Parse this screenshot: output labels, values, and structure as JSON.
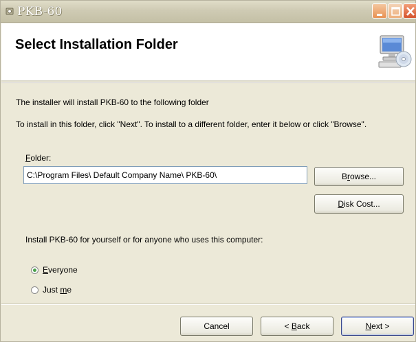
{
  "window": {
    "title": "PKB-60",
    "icon": "setup-icon",
    "controls": [
      "minimize-icon",
      "maximize-icon",
      "close-icon"
    ]
  },
  "banner": {
    "title": "Select Installation Folder",
    "icon": "computer-disc-icon"
  },
  "body": {
    "line1": "The installer will install PKB-60 to the following folder",
    "line2": "To install in this folder, click \"Next\". To install to a different folder, enter it below or click \"Browse\".",
    "folder_label_accel": "F",
    "folder_label_rest": "older:",
    "folder_value": "C:\\Program Files\\ Default Company Name\\ PKB-60\\",
    "browse_pre": "B",
    "browse_accel": "r",
    "browse_post": "owse...",
    "diskcost_accel": "D",
    "diskcost_rest": "isk Cost...",
    "install_for": "Install PKB-60 for yourself or for anyone who uses this computer:",
    "options": [
      {
        "accel": "E",
        "rest": "veryone",
        "selected": true
      },
      {
        "pre": "Just ",
        "accel": "m",
        "rest": "e",
        "selected": false
      }
    ]
  },
  "footer": {
    "cancel": "Cancel",
    "back_pre": "< ",
    "back_accel": "B",
    "back_rest": "ack",
    "next_accel": "N",
    "next_rest": "ext >"
  },
  "colors": {
    "window_bg": "#ece9d8",
    "titlebar": "#cfcbb4",
    "close_button": "#d5532d"
  }
}
